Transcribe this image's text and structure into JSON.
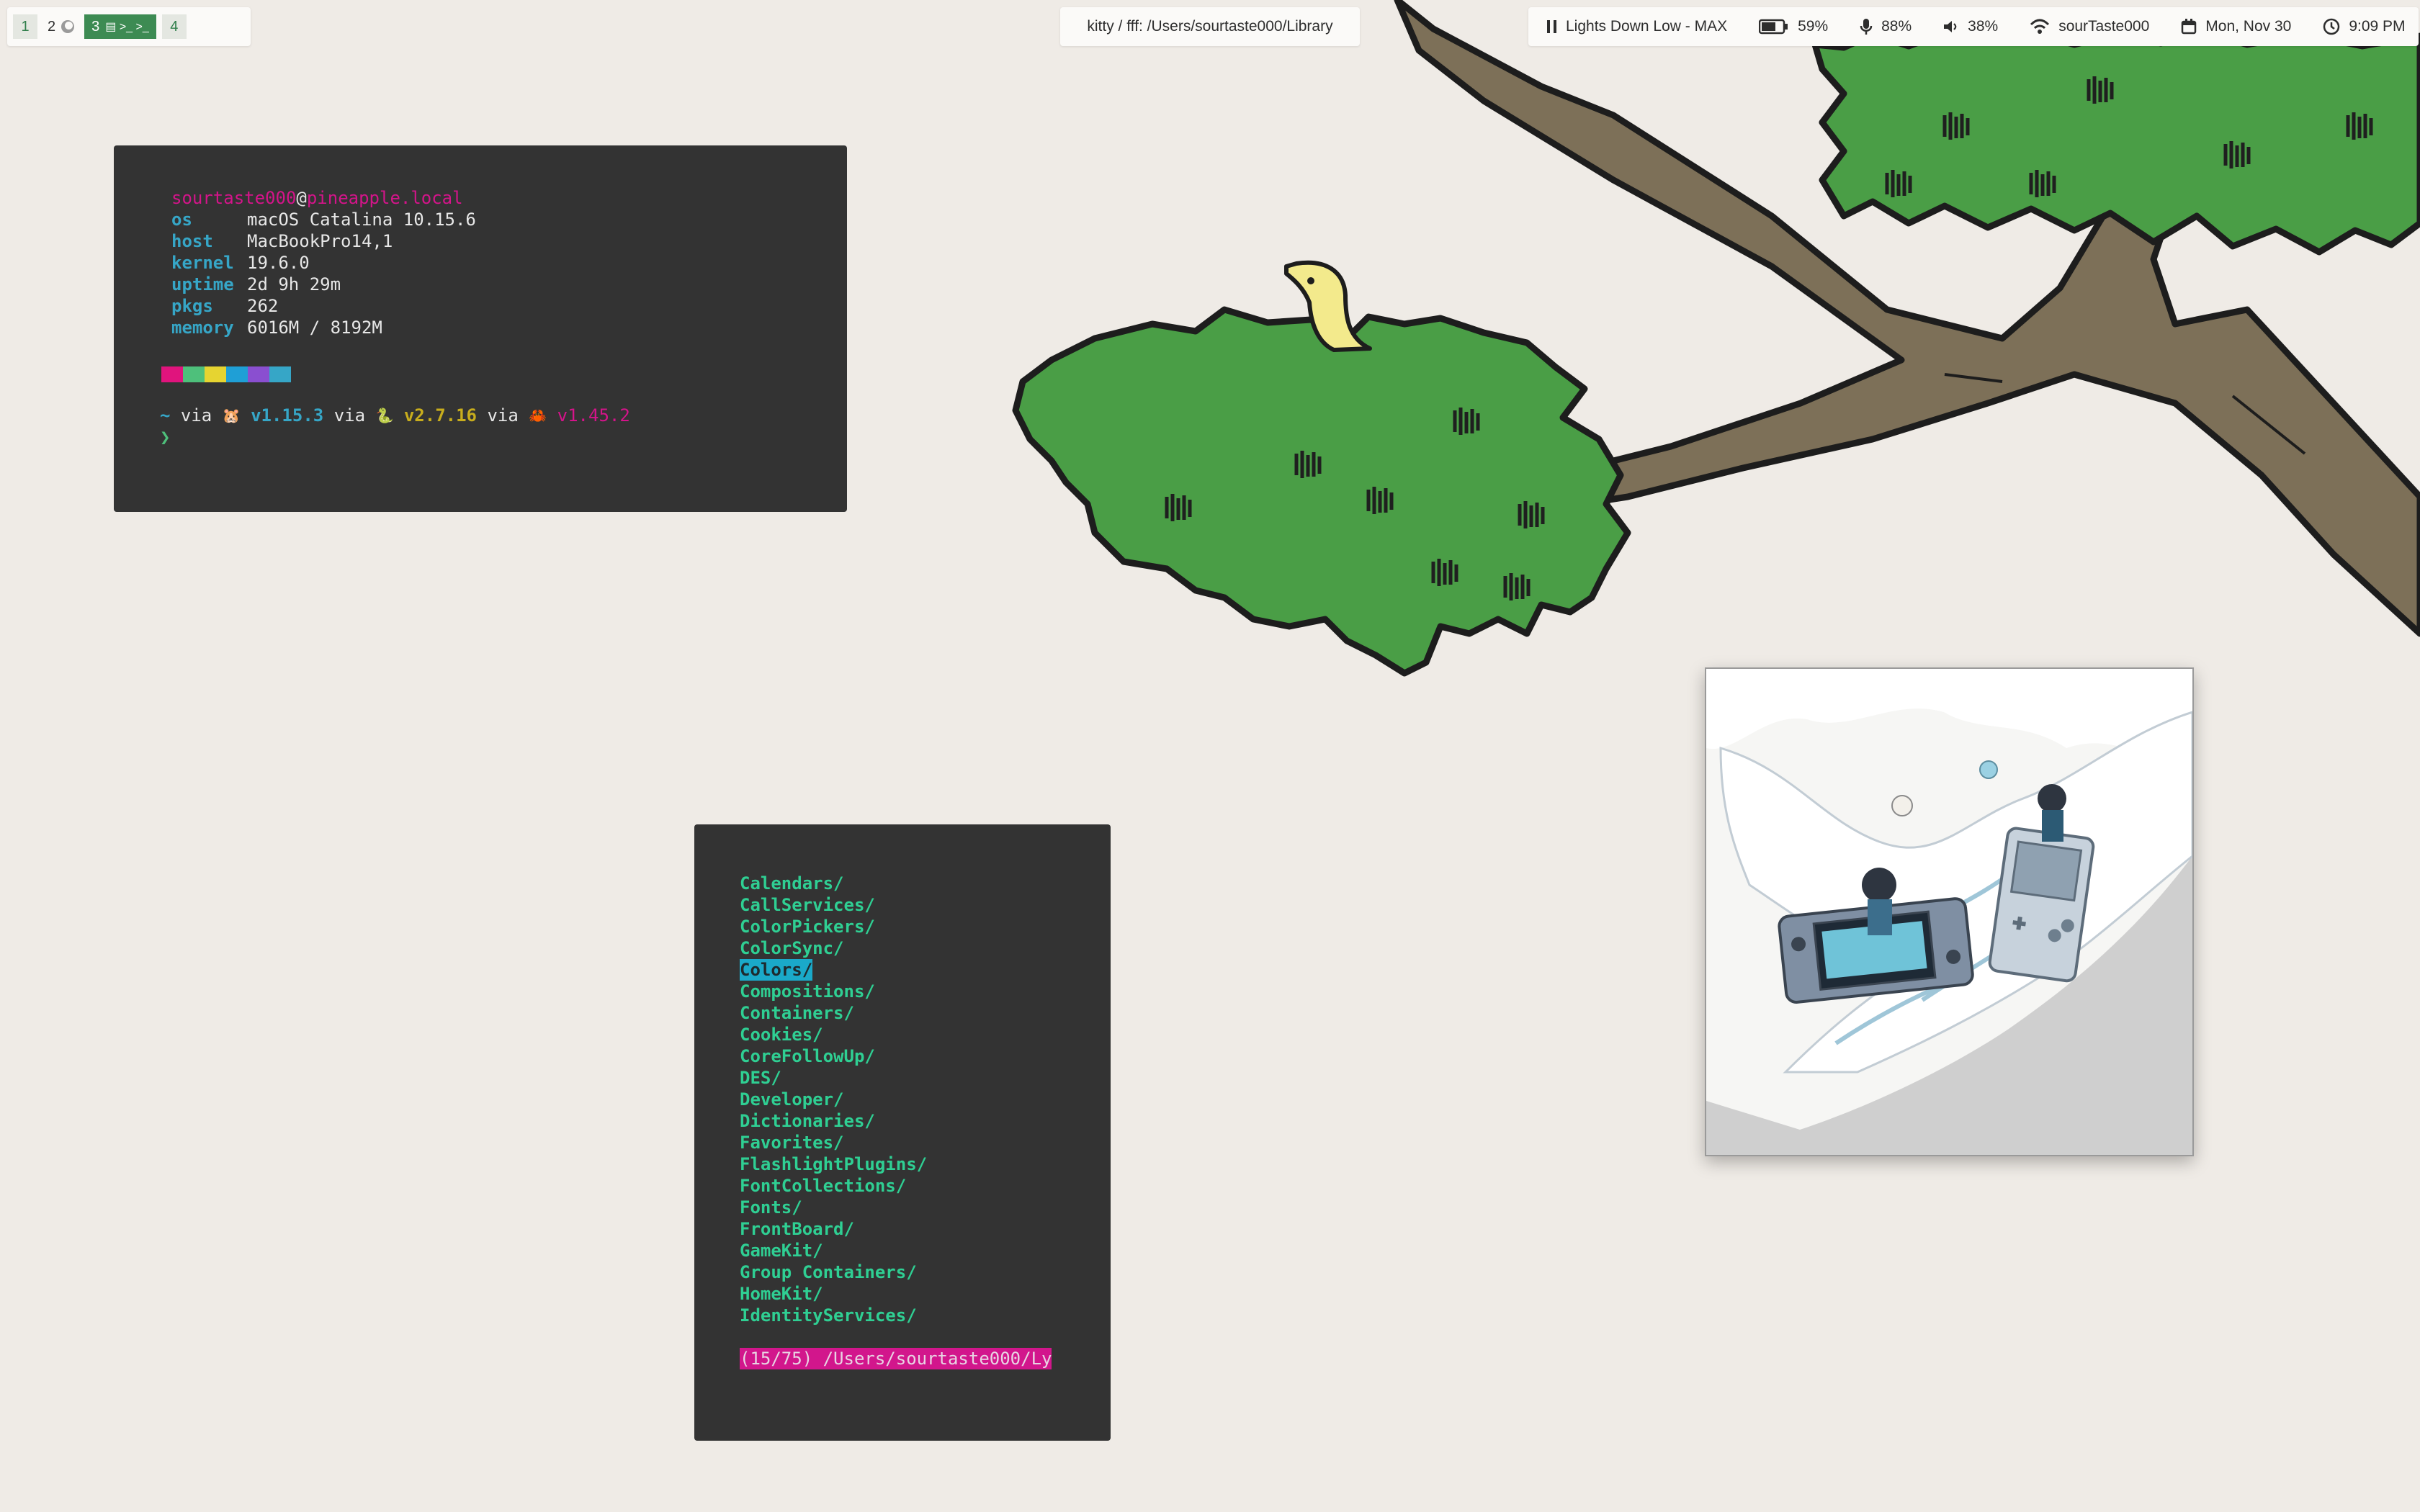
{
  "workspaces": [
    {
      "id": "1",
      "icons": ""
    },
    {
      "id": "2",
      "icons": "moon"
    },
    {
      "id": "3",
      "icons": "▤ >_ >_",
      "active": true
    },
    {
      "id": "4",
      "icons": ""
    }
  ],
  "window_title": "kitty / fff: /Users/sourtaste000/Library",
  "status": {
    "music": "Lights Down Low - MAX",
    "battery": "59%",
    "mic": "88%",
    "volume": "38%",
    "wifi": "sourTaste000",
    "date": "Mon, Nov 30",
    "time": "9:09 PM"
  },
  "fetch": {
    "user": "sourtaste000",
    "at": "@",
    "host": "pineapple.local",
    "rows": [
      {
        "key": "os",
        "value": "macOS Catalina 10.15.6"
      },
      {
        "key": "host",
        "value": "MacBookPro14,1"
      },
      {
        "key": "kernel",
        "value": "19.6.0"
      },
      {
        "key": "uptime",
        "value": "2d 9h 29m"
      },
      {
        "key": "pkgs",
        "value": "262"
      },
      {
        "key": "memory",
        "value": "6016M / 8192M"
      }
    ],
    "palette": [
      "#e0147d",
      "#4ec07b",
      "#e6d431",
      "#1f9fd6",
      "#8a4fd0",
      "#36a6c7"
    ],
    "prompt": {
      "tilde": "~",
      "via1": "via",
      "v1": "v1.15.3",
      "via2": "via",
      "v2": "v2.7.16",
      "via3": "via",
      "v3": "v1.45.2",
      "cursor": "❯"
    }
  },
  "fff": {
    "entries": [
      "Calendars/",
      "CallServices/",
      "ColorPickers/",
      "ColorSync/",
      "Colors/",
      "Compositions/",
      "Containers/",
      "Cookies/",
      "CoreFollowUp/",
      "DES/",
      "Developer/",
      "Dictionaries/",
      "Favorites/",
      "FlashlightPlugins/",
      "FontCollections/",
      "Fonts/",
      "FrontBoard/",
      "GameKit/",
      "Group Containers/",
      "HomeKit/",
      "IdentityServices/"
    ],
    "selected_index": 4,
    "status": "(15/75) /Users/sourtaste000/Ly"
  },
  "colors": {
    "background": "#efebe6",
    "terminal": "#333333",
    "accent_green": "#3d8b53",
    "magenta": "#d4148a",
    "cyan": "#36a6c7"
  }
}
